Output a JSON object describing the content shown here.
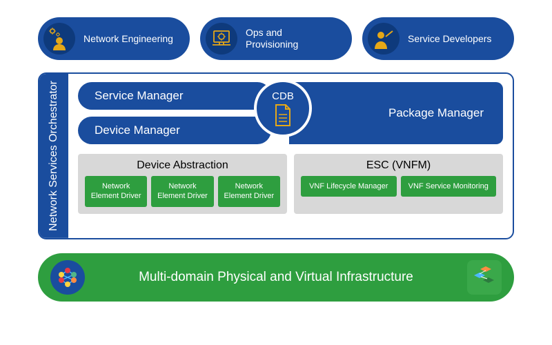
{
  "personas": [
    {
      "label": "Network Engineering",
      "icon": "engineer"
    },
    {
      "label": "Ops and Provisioning",
      "icon": "ops"
    },
    {
      "label": "Service Developers",
      "icon": "developer"
    }
  ],
  "orchestrator": {
    "sidebar": "Network Services Orchestrator",
    "service_manager": "Service Manager",
    "device_manager": "Device Manager",
    "cdb": "CDB",
    "package_manager": "Package Manager",
    "device_abstraction": {
      "title": "Device Abstraction",
      "drivers": [
        "Network Element Driver",
        "Network Element Driver",
        "Network Element Driver"
      ]
    },
    "esc": {
      "title": "ESC (VNFM)",
      "items": [
        "VNF Lifecycle Manager",
        "VNF Service Monitoring"
      ]
    }
  },
  "footer": {
    "label": "Multi-domain Physical and Virtual Infrastructure"
  },
  "colors": {
    "blue": "#1a4d9e",
    "green": "#2e9e3f",
    "gold": "#e6a817"
  }
}
